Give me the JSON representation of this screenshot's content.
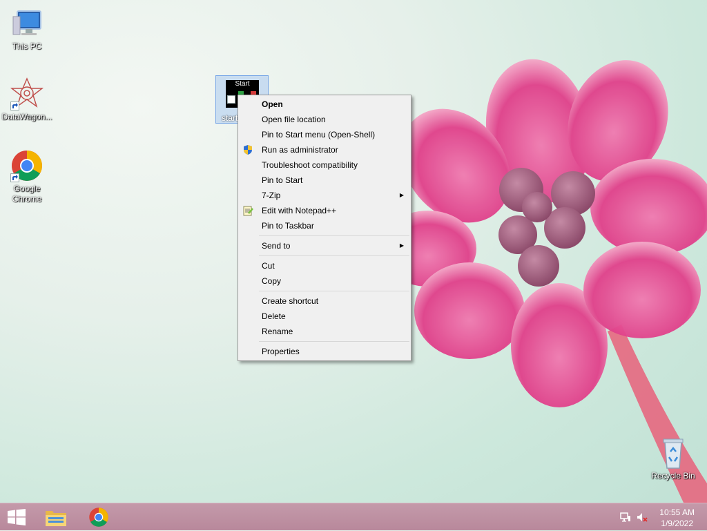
{
  "desktop": {
    "icons": [
      {
        "label": "This PC"
      },
      {
        "label": "DataWagon..."
      },
      {
        "label": "Google Chrome"
      },
      {
        "label": "start"
      },
      {
        "label": "Recycle Bin"
      }
    ],
    "selected_thumb_text": "Start"
  },
  "context_menu": {
    "items": [
      {
        "label": "Open",
        "icon": "",
        "bold": true
      },
      {
        "label": "Open file location"
      },
      {
        "label": "Pin to Start menu (Open-Shell)"
      },
      {
        "label": "Run as administrator",
        "icon": "uac-shield-icon"
      },
      {
        "label": "Troubleshoot compatibility"
      },
      {
        "label": "Pin to Start"
      },
      {
        "label": "7-Zip",
        "submenu": true
      },
      {
        "label": "Edit with Notepad++",
        "icon": "notepad-plus-plus-icon"
      },
      {
        "label": "Pin to Taskbar"
      },
      {
        "label": "Send to",
        "submenu": true
      },
      {
        "label": "Cut"
      },
      {
        "label": "Copy"
      },
      {
        "label": "Create shortcut"
      },
      {
        "label": "Delete"
      },
      {
        "label": "Rename"
      },
      {
        "label": "Properties"
      }
    ],
    "submenu_arrow": "▶"
  },
  "taskbar": {
    "start_icon": "windows-logo-icon",
    "pinned": [
      "file-explorer-icon",
      "chrome-icon"
    ],
    "clock_time": "10:55 AM",
    "clock_date": "1/9/2022"
  },
  "colors": {
    "taskbar": "#bb8c9e",
    "menu_bg": "#f0f0f0",
    "flower": "#e0408a"
  }
}
